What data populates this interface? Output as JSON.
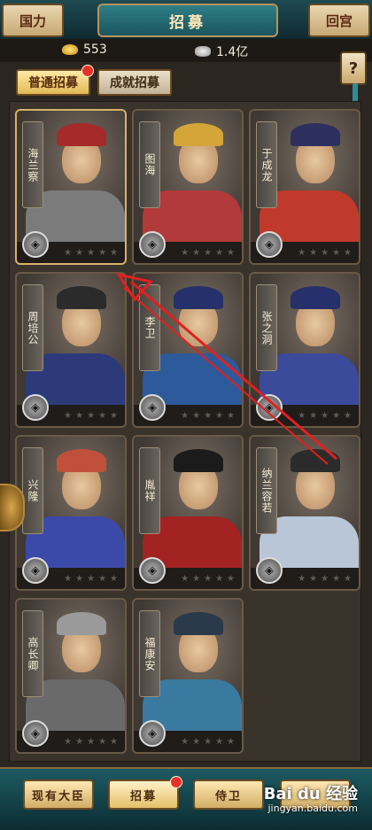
{
  "header": {
    "left_button": "国力",
    "title": "招募",
    "right_button": "回宫"
  },
  "resources": {
    "gold": "553",
    "silver": "1.4亿"
  },
  "tabs": [
    {
      "label": "普通招募",
      "active": true,
      "badge": true
    },
    {
      "label": "成就招募",
      "active": false,
      "badge": false
    }
  ],
  "help": {
    "label": "?"
  },
  "cards": [
    {
      "name": "海兰察",
      "hat": "#a52a2a",
      "robe": "#7b7b7b",
      "icon": "helmet-icon"
    },
    {
      "name": "图海",
      "hat": "#d4a63a",
      "robe": "#b23a3a",
      "icon": "helmet-icon"
    },
    {
      "name": "于成龙",
      "hat": "#2d2f5e",
      "robe": "#c0392b",
      "icon": "book-icon"
    },
    {
      "name": "周培公",
      "hat": "#2b2b2b",
      "robe": "#2d3a7a",
      "icon": "flag-icon"
    },
    {
      "name": "李卫",
      "hat": "#26306a",
      "robe": "#2d5a9a",
      "icon": "scroll-icon"
    },
    {
      "name": "张之洞",
      "hat": "#26306a",
      "robe": "#3b4a9a",
      "icon": "book-icon"
    },
    {
      "name": "兴隆",
      "hat": "#c0503a",
      "robe": "#3b4aa8",
      "icon": "scroll-icon"
    },
    {
      "name": "胤祥",
      "hat": "#1b1b1b",
      "robe": "#a32222",
      "icon": "helmet-icon"
    },
    {
      "name": "纳兰容若",
      "hat": "#2b2b2b",
      "robe": "#b9c6d8",
      "icon": "book-icon"
    },
    {
      "name": "高长卿",
      "hat": "#9a9a9a",
      "robe": "#6a6a6a",
      "icon": "mask-icon"
    },
    {
      "name": "福康安",
      "hat": "#2a3a4a",
      "robe": "#3a7aa0",
      "icon": "helmet-icon"
    }
  ],
  "bottom_nav": [
    {
      "label": "现有大臣",
      "active": false,
      "badge": false
    },
    {
      "label": "招募",
      "active": true,
      "badge": true
    },
    {
      "label": "侍卫",
      "active": false,
      "badge": false
    },
    {
      "label": "",
      "active": false,
      "badge": false
    }
  ],
  "watermark": {
    "brand": "Bai du 经验",
    "url": "jingyan.baidu.com"
  },
  "colors": {
    "teal_bar": "#1d5a62",
    "badge_red": "#e5322b",
    "arrow_red": "#e02020"
  }
}
